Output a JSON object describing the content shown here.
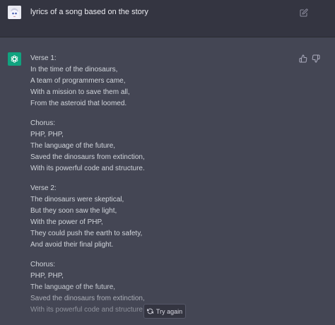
{
  "user_message": {
    "avatar_icon": "anime-avatar-icon",
    "text": "lyrics of a song based on the story",
    "edit_icon": "edit-icon"
  },
  "assistant_message": {
    "avatar_icon": "openai-logo-icon",
    "feedback_icons": [
      "thumbs-up-icon",
      "thumbs-down-icon"
    ],
    "stanzas": [
      {
        "lines": [
          "Verse 1:",
          "In the time of the dinosaurs,",
          "A team of programmers came,",
          "With a mission to save them all,",
          "From the asteroid that loomed."
        ]
      },
      {
        "lines": [
          "Chorus:",
          "PHP, PHP,",
          "The language of the future,",
          "Saved the dinosaurs from extinction,",
          "With its powerful code and structure."
        ]
      },
      {
        "lines": [
          "Verse 2:",
          "The dinosaurs were skeptical,",
          "But they soon saw the light,",
          "With the power of PHP,",
          "They could push the earth to safety,",
          "And avoid their final plight."
        ]
      },
      {
        "lines": [
          "Chorus:",
          "PHP, PHP,",
          "The language of the future,",
          "Saved the dinosaurs from extinction,",
          "With its powerful code and structure"
        ]
      }
    ]
  },
  "try_again_button": {
    "label": "Try again",
    "icon": "refresh-icon"
  },
  "colors": {
    "user_row_bg": "#343541",
    "assistant_row_bg": "#444654",
    "accent": "#10a37f",
    "text": "#d1d5db"
  }
}
